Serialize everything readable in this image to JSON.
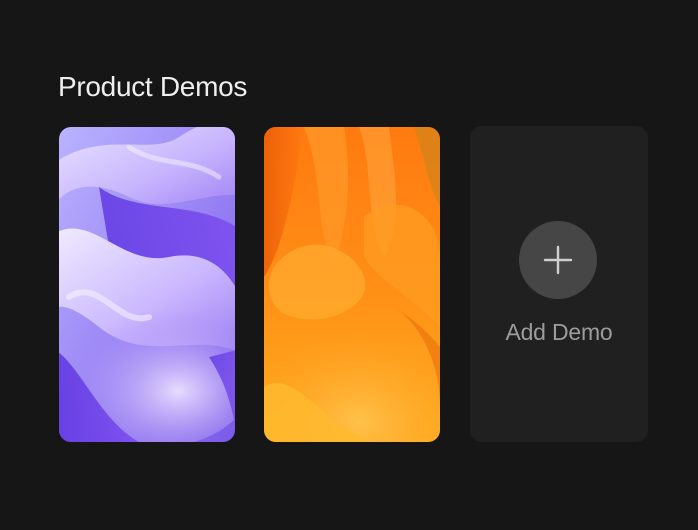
{
  "section": {
    "title": "Product Demos"
  },
  "demos": [
    {
      "thumbnail": "purple-abstract-waves",
      "accent": "#8a6cf2"
    },
    {
      "thumbnail": "orange-abstract-smoke",
      "accent": "#ff8a14"
    }
  ],
  "add_card": {
    "icon": "plus-icon",
    "label": "Add Demo"
  },
  "colors": {
    "background": "#161616",
    "card": "#202020",
    "add_circle": "#464646",
    "title_text": "#eeeeee",
    "label_text": "#9c9c9c"
  }
}
